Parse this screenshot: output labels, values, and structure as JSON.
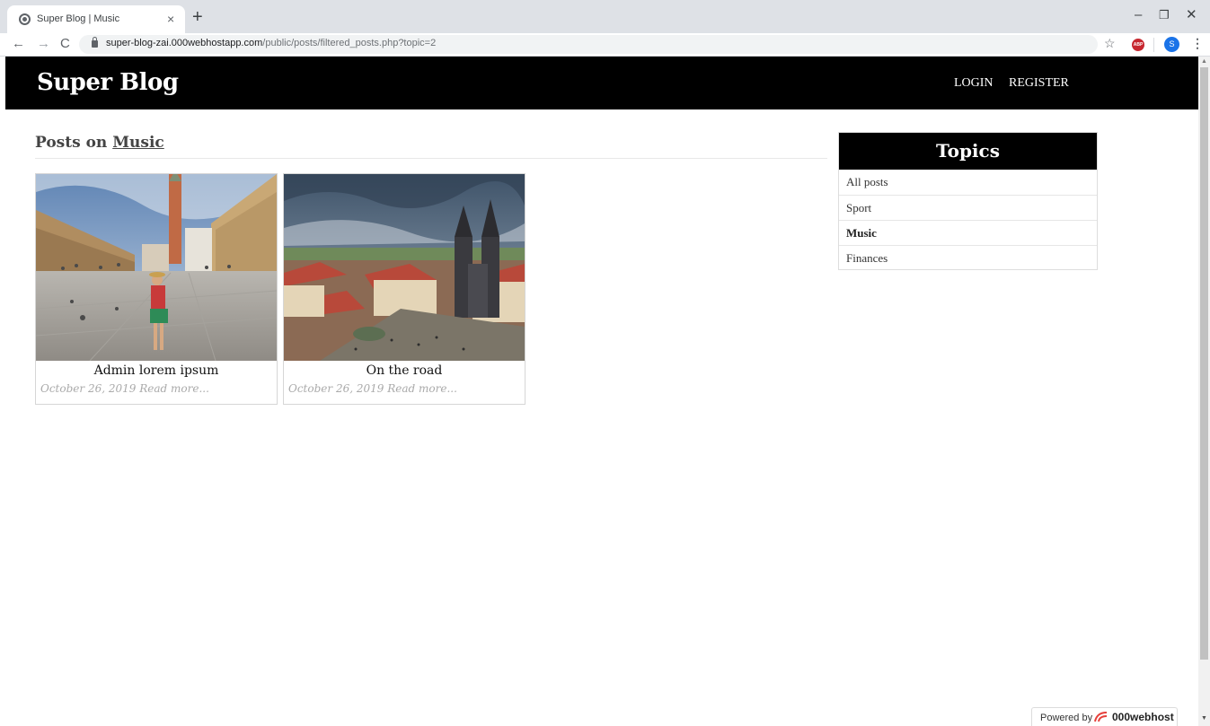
{
  "browser": {
    "tab_title": "Super Blog | Music",
    "tab_close": "×",
    "new_tab": "+",
    "url_host": "super-blog-zai.000webhostapp.com",
    "url_path": "/public/posts/filtered_posts.php?topic=2",
    "win_minimize": "–",
    "win_restore": "❐",
    "win_close": "✕",
    "nav_back": "←",
    "nav_forward": "→",
    "nav_reload": "C",
    "bookmark_star": "☆",
    "abp_label": "ABP",
    "profile_initial": "S",
    "menu": "⋮"
  },
  "header": {
    "logo": "Super Blog",
    "nav": [
      {
        "label": "LOGIN"
      },
      {
        "label": "REGISTER"
      }
    ]
  },
  "main": {
    "heading_prefix": "Posts on ",
    "heading_topic": "Music",
    "posts": [
      {
        "title": "Admin lorem ipsum",
        "date": "October 26, 2019",
        "read_more": "Read more..."
      },
      {
        "title": "On the road",
        "date": "October 26, 2019",
        "read_more": "Read more..."
      }
    ]
  },
  "sidebar": {
    "title": "Topics",
    "topics": [
      {
        "label": "All posts"
      },
      {
        "label": "Sport"
      },
      {
        "label": "Music"
      },
      {
        "label": "Finances"
      }
    ]
  },
  "footer": {
    "powered_by": "Powered by",
    "brand": "000webhost"
  },
  "colors": {
    "header_bg": "#000000",
    "meta_text": "#aaaaaa",
    "abp_red": "#c7272f",
    "profile_blue": "#1a73e8"
  }
}
